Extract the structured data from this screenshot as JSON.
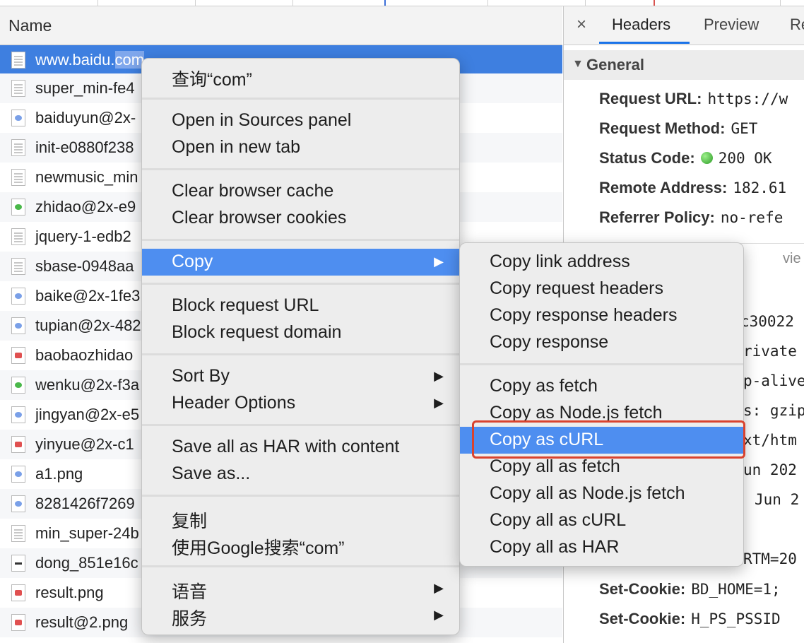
{
  "network_list": {
    "header": "Name",
    "rows": [
      {
        "name_prefix": "www.baidu.",
        "name_highlight": "com",
        "icon": "document-icon",
        "selected": true
      },
      {
        "name": "super_min-fe4",
        "icon": "document-icon"
      },
      {
        "name": "baiduyun@2x-",
        "icon": "image-icon"
      },
      {
        "name": "init-e0880f238",
        "icon": "document-icon"
      },
      {
        "name": "newmusic_min",
        "icon": "document-icon"
      },
      {
        "name": "zhidao@2x-e9",
        "icon": "image-icon"
      },
      {
        "name": "jquery-1-edb2",
        "icon": "document-icon"
      },
      {
        "name": "sbase-0948aa",
        "icon": "document-icon"
      },
      {
        "name": "baike@2x-1fe3",
        "icon": "image-icon"
      },
      {
        "name": "tupian@2x-482",
        "icon": "image-icon"
      },
      {
        "name": "baobaozhidao",
        "icon": "image-icon"
      },
      {
        "name": "wenku@2x-f3a",
        "icon": "image-icon"
      },
      {
        "name": "jingyan@2x-e5",
        "icon": "image-icon"
      },
      {
        "name": "yinyue@2x-c1",
        "icon": "image-icon"
      },
      {
        "name": "a1.png",
        "icon": "image-icon"
      },
      {
        "name": "8281426f7269",
        "icon": "image-icon"
      },
      {
        "name": "min_super-24b",
        "icon": "document-icon"
      },
      {
        "name": "dong_851e16c",
        "icon": "image-icon"
      },
      {
        "name": "result.png",
        "icon": "image-icon"
      },
      {
        "name": "result@2.png",
        "icon": "image-icon"
      }
    ]
  },
  "details": {
    "close": "×",
    "tabs": [
      "Headers",
      "Preview",
      "Re"
    ],
    "general_label": "General",
    "general_rows": [
      {
        "key": "Request URL:",
        "value": "https://w"
      },
      {
        "key": "Request Method:",
        "value": "GET"
      },
      {
        "key": "Status Code:",
        "value": "200 OK"
      },
      {
        "key": "Remote Address:",
        "value": "182.61"
      },
      {
        "key": "Referrer Policy:",
        "value": "no-refe"
      }
    ],
    "view_source": "vie",
    "fragments": [
      "c30022",
      "rivate",
      "p-alive",
      "s: gzip",
      "xt/htm",
      "un 202",
      "Jun 2",
      "RTM=20"
    ],
    "set_cookie_rows": [
      {
        "key": "Set-Cookie:",
        "value": "BD_HOME=1;"
      },
      {
        "key": "Set-Cookie:",
        "value": "H_PS_PSSID"
      }
    ]
  },
  "context_menu": {
    "items": [
      {
        "label": "查询“com”"
      },
      {
        "label": "Open in Sources panel"
      },
      {
        "label": "Open in new tab"
      },
      {
        "label": "Clear browser cache"
      },
      {
        "label": "Clear browser cookies"
      },
      {
        "label": "Copy",
        "arrow": "▶"
      },
      {
        "label": "Block request URL"
      },
      {
        "label": "Block request domain"
      },
      {
        "label": "Sort By",
        "arrow": "▶"
      },
      {
        "label": "Header Options",
        "arrow": "▶"
      },
      {
        "label": "Save all as HAR with content"
      },
      {
        "label": "Save as..."
      },
      {
        "label": "复制"
      },
      {
        "label": "使用Google搜索“com”"
      },
      {
        "label": "语音",
        "arrow": "▶"
      },
      {
        "label": "服务",
        "arrow": "▶"
      }
    ]
  },
  "copy_submenu": {
    "items": [
      {
        "label": "Copy link address"
      },
      {
        "label": "Copy request headers"
      },
      {
        "label": "Copy response headers"
      },
      {
        "label": "Copy response"
      },
      {
        "label": "Copy as fetch"
      },
      {
        "label": "Copy as Node.js fetch"
      },
      {
        "label": "Copy as cURL"
      },
      {
        "label": "Copy all as fetch"
      },
      {
        "label": "Copy all as Node.js fetch"
      },
      {
        "label": "Copy all as cURL"
      },
      {
        "label": "Copy all as HAR"
      }
    ]
  },
  "colors": {
    "selection_blue": "#3e7fe0",
    "menu_highlight": "#4e8ef0",
    "annotation_red": "#d9432f",
    "status_green": "#2c9b26"
  }
}
